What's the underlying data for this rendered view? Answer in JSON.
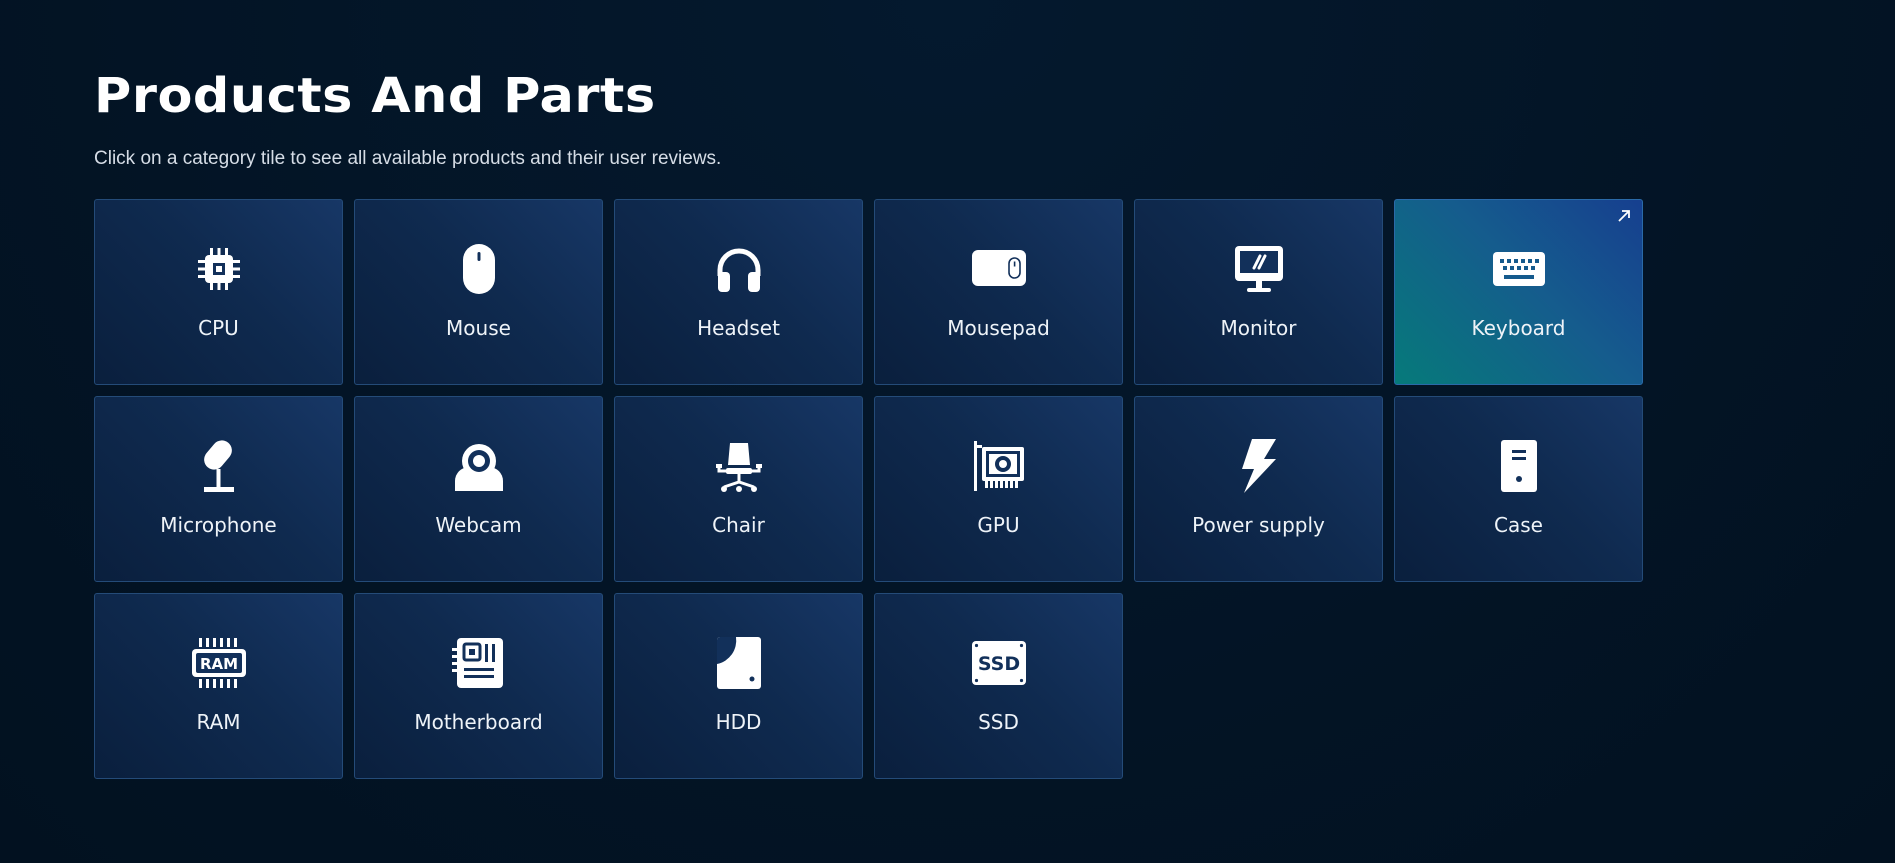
{
  "header": {
    "title": "Products And Parts",
    "subtitle": "Click on a category tile to see all available products and their user reviews."
  },
  "categories": [
    {
      "label": "CPU",
      "icon": "cpu-icon",
      "active": false
    },
    {
      "label": "Mouse",
      "icon": "mouse-icon",
      "active": false
    },
    {
      "label": "Headset",
      "icon": "headset-icon",
      "active": false
    },
    {
      "label": "Mousepad",
      "icon": "mousepad-icon",
      "active": false
    },
    {
      "label": "Monitor",
      "icon": "monitor-icon",
      "active": false
    },
    {
      "label": "Keyboard",
      "icon": "keyboard-icon",
      "active": true
    },
    {
      "label": "Microphone",
      "icon": "microphone-icon",
      "active": false
    },
    {
      "label": "Webcam",
      "icon": "webcam-icon",
      "active": false
    },
    {
      "label": "Chair",
      "icon": "chair-icon",
      "active": false
    },
    {
      "label": "GPU",
      "icon": "gpu-icon",
      "active": false
    },
    {
      "label": "Power supply",
      "icon": "power-supply-icon",
      "active": false
    },
    {
      "label": "Case",
      "icon": "case-icon",
      "active": false
    },
    {
      "label": "RAM",
      "icon": "ram-icon",
      "active": false
    },
    {
      "label": "Motherboard",
      "icon": "motherboard-icon",
      "active": false
    },
    {
      "label": "HDD",
      "icon": "hdd-icon",
      "active": false
    },
    {
      "label": "SSD",
      "icon": "ssd-icon",
      "active": false
    }
  ],
  "icon_labels": {
    "ram": "RAM",
    "ssd": "SSD"
  },
  "colors": {
    "background": "#03162a",
    "tile": "#0f2a4f",
    "tile_border": "#244b78",
    "active_tile_start": "#163f8f",
    "active_tile_end": "#067a7a",
    "text": "#ffffff"
  }
}
